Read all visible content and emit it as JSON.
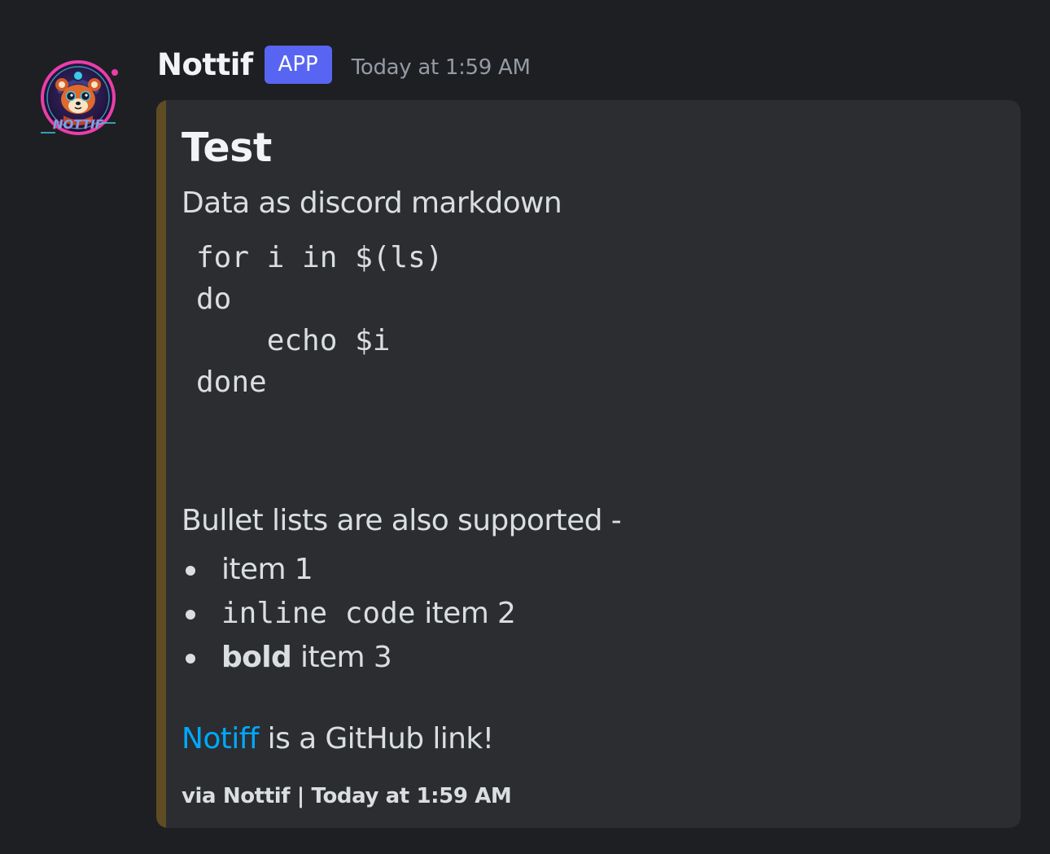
{
  "message": {
    "author": "Nottif",
    "badge": "APP",
    "timestamp": "Today at 1:59 AM",
    "avatar_icon": "red-panda-logo-icon",
    "avatar_logo_text": "NOTTIF"
  },
  "embed": {
    "accent_color": "#5f4c23",
    "title": "Test",
    "description": "Data as discord markdown",
    "code_lines": [
      "for i in $(ls)",
      "do",
      "    echo $i",
      "done"
    ],
    "bullet_intro": "Bullet lists are also supported -",
    "bullets": [
      {
        "text": "item 1"
      },
      {
        "code": "inline code",
        "text": " item 2"
      },
      {
        "bold": "bold",
        "text": " item 3"
      }
    ],
    "link_text": "Notiff",
    "link_suffix": " is a GitHub link!",
    "footer": "via Nottif | Today at 1:59 AM"
  },
  "colors": {
    "background": "#1e1f23",
    "embed_background": "#2b2d31",
    "badge": "#5865f2",
    "link": "#00a8fc"
  }
}
